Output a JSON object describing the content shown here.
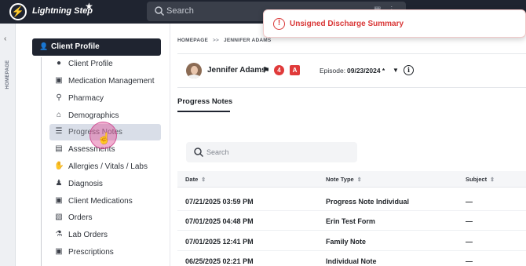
{
  "app": {
    "brand": "Lightning Step"
  },
  "topbar": {
    "search_placeholder": "Search"
  },
  "toast": {
    "message": "Unsigned Discharge Summary",
    "color": "#d93838"
  },
  "rail": {
    "label": "HOMEPAGE"
  },
  "nav": {
    "header": "Client Profile",
    "items": [
      {
        "label": "Client Profile",
        "icon": "user-icon"
      },
      {
        "label": "Medication Management",
        "icon": "briefcase-icon"
      },
      {
        "label": "Pharmacy",
        "icon": "search-icon"
      },
      {
        "label": "Demographics",
        "icon": "home-icon"
      },
      {
        "label": "Progress Notes",
        "icon": "list-icon",
        "active": true
      },
      {
        "label": "Assessments",
        "icon": "document-icon"
      },
      {
        "label": "Allergies / Vitals / Labs",
        "icon": "hand-icon"
      },
      {
        "label": "Diagnosis",
        "icon": "user-group-icon"
      },
      {
        "label": "Client Medications",
        "icon": "briefcase-icon"
      },
      {
        "label": "Orders",
        "icon": "clipboard-icon"
      },
      {
        "label": "Lab Orders",
        "icon": "flask-icon"
      },
      {
        "label": "Prescriptions",
        "icon": "briefcase-icon"
      }
    ]
  },
  "breadcrumb": {
    "home": "HOMEPAGE",
    "separator": ">>",
    "current": "JENNIFER ADAMS"
  },
  "client": {
    "name": "Jennifer Adams",
    "alert_count": "4",
    "badge_letter": "A",
    "episode_label": "Episode:",
    "episode_value": "09/23/2024 *"
  },
  "tabs": {
    "active": "Progress Notes"
  },
  "notes": {
    "search_placeholder": "Search",
    "columns": {
      "date": "Date",
      "note_type": "Note Type",
      "subject": "Subject"
    },
    "rows": [
      {
        "date": "07/21/2025 03:59 PM",
        "note_type": "Progress Note Individual",
        "subject": "—"
      },
      {
        "date": "07/01/2025 04:48 PM",
        "note_type": "Erin Test Form",
        "subject": "—"
      },
      {
        "date": "07/01/2025 12:41 PM",
        "note_type": "Family Note",
        "subject": "—"
      },
      {
        "date": "06/25/2025 02:21 PM",
        "note_type": "Individual Note",
        "subject": "—"
      }
    ]
  }
}
